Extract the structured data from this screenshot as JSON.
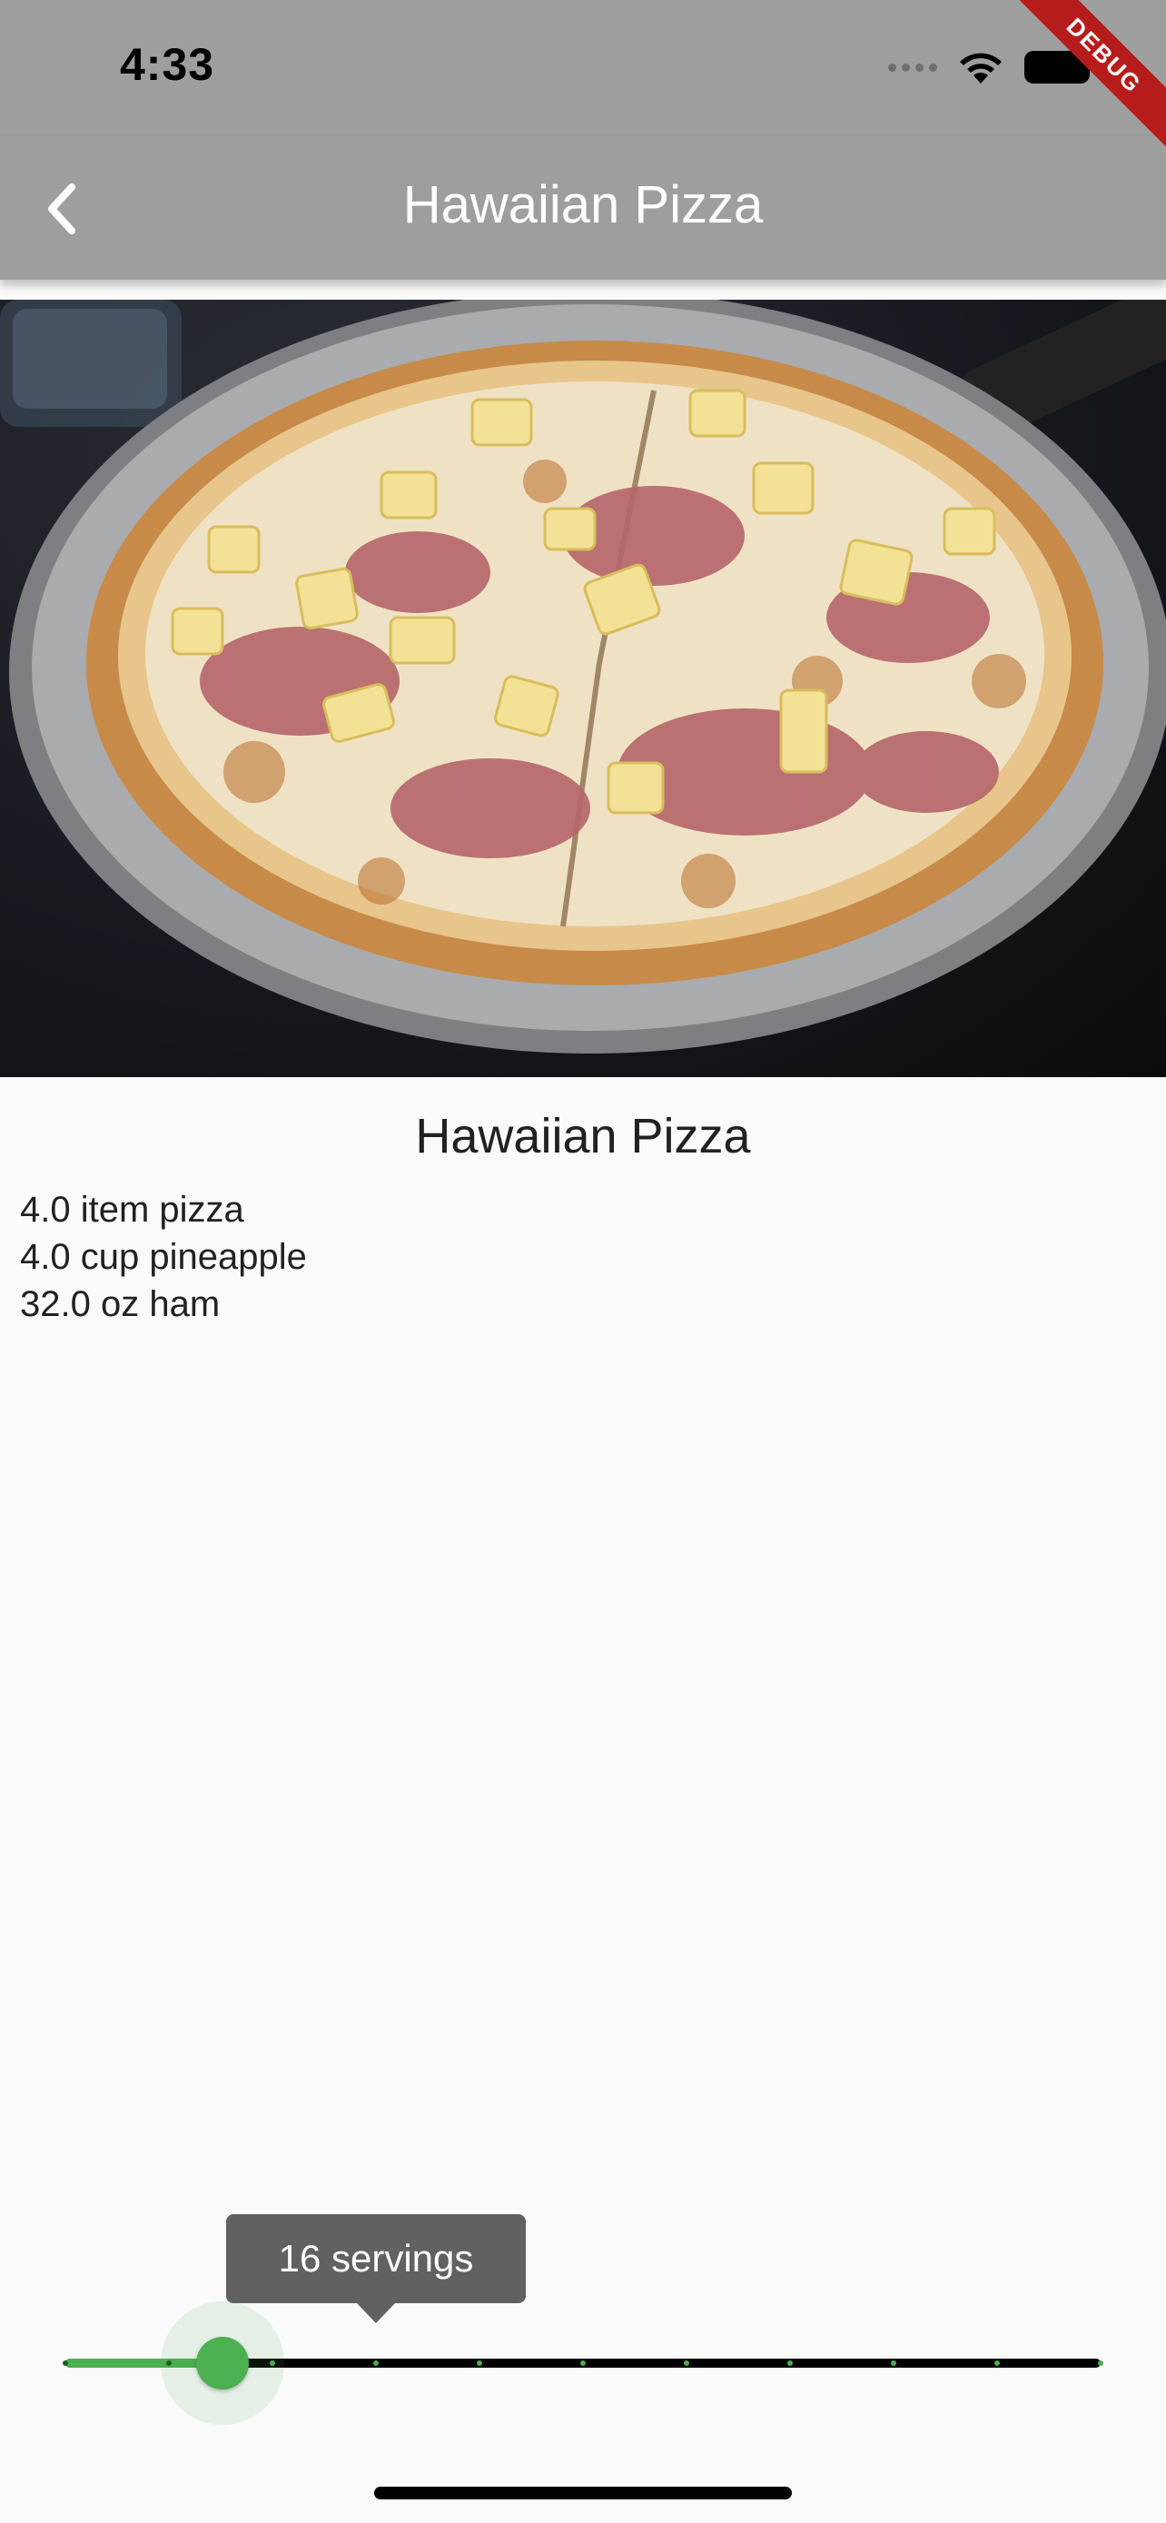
{
  "status_bar": {
    "time": "4:33",
    "icons": [
      "cellular-signal-icon",
      "wifi-icon",
      "battery-icon"
    ]
  },
  "debug_banner": {
    "label": "DEBUG"
  },
  "app_bar": {
    "title": "Hawaiian Pizza",
    "back_icon": "chevron-left-icon",
    "background_color": "#9e9e9e"
  },
  "recipe": {
    "image_subject": "hawaiian-pizza-photo",
    "title": "Hawaiian Pizza",
    "ingredients": [
      "4.0 item pizza",
      "4.0 cup pineapple",
      "32.0 oz ham"
    ]
  },
  "servings_slider": {
    "value_label": "16 servings",
    "value": 16,
    "min": 1,
    "max": 100,
    "divisions": 10,
    "active_color": "#4caf50",
    "inactive_color": "#000000"
  }
}
